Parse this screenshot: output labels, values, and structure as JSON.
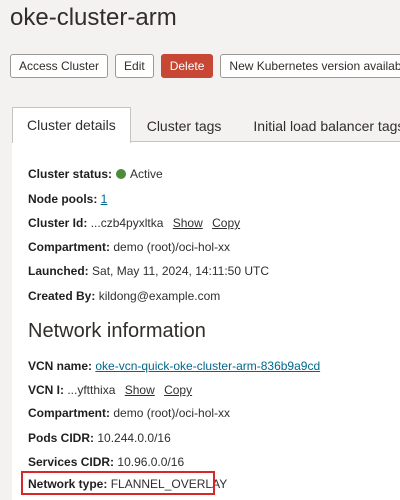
{
  "header": {
    "title": "oke-cluster-arm"
  },
  "toolbar": {
    "access_cluster": "Access Cluster",
    "edit": "Edit",
    "delete": "Delete",
    "new_k8s_version": "New Kubernetes version available"
  },
  "tabs": [
    {
      "label": "Cluster details",
      "active": true
    },
    {
      "label": "Cluster tags",
      "active": false
    },
    {
      "label": "Initial load balancer tags",
      "active": false
    }
  ],
  "cluster_details": {
    "status_label": "Cluster status:",
    "status_value": "Active",
    "status_color": "#4c8a3c",
    "node_pools_label": "Node pools:",
    "node_pools_value": "1",
    "cluster_id_label": "Cluster Id:",
    "cluster_id_value": "...czb4pyxltka",
    "show": "Show",
    "copy": "Copy",
    "compartment_label": "Compartment:",
    "compartment_value": "demo (root)/oci-hol-xx",
    "launched_label": "Launched:",
    "launched_value": "Sat, May 11, 2024, 14:11:50 UTC",
    "created_by_label": "Created By:",
    "created_by_value": "kildong@example.com"
  },
  "network": {
    "heading": "Network information",
    "vcn_name_label": "VCN name:",
    "vcn_name_value": "oke-vcn-quick-oke-cluster-arm-836b9a9cd",
    "vcn_id_label": "VCN I:",
    "vcn_id_value": "...yftthixa",
    "show": "Show",
    "copy": "Copy",
    "compartment_label": "Compartment:",
    "compartment_value": "demo (root)/oci-hol-xx",
    "pods_cidr_label": "Pods CIDR:",
    "pods_cidr_value": "10.244.0.0/16",
    "services_cidr_label": "Services CIDR:",
    "services_cidr_value": "10.96.0.0/16",
    "network_type_label": "Network type:",
    "network_type_value": "FLANNEL_OVERLAY"
  },
  "colors": {
    "danger": "#c74634",
    "link": "#00688c",
    "highlight": "#d9262b"
  }
}
